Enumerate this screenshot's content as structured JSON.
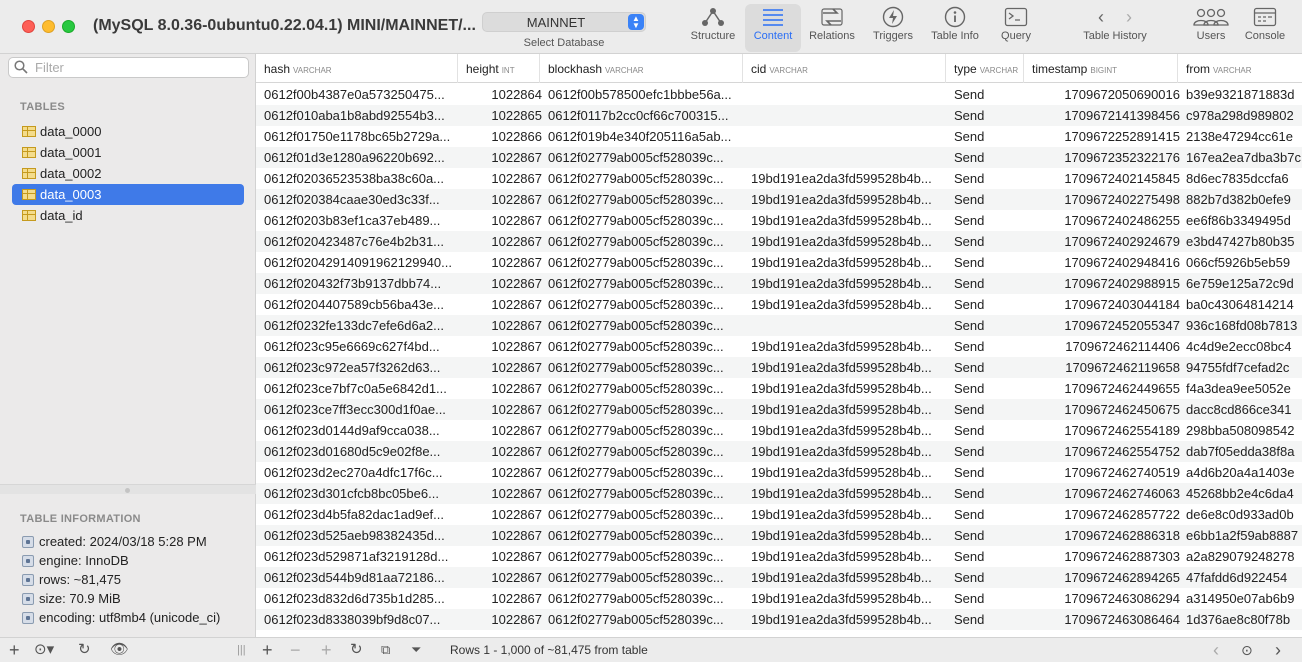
{
  "window": {
    "title": "(MySQL 8.0.36-0ubuntu0.22.04.1) MINI/MAINNET/..."
  },
  "db_select": {
    "value": "MAINNET",
    "caption": "Select Database"
  },
  "toolbar": {
    "structure": "Structure",
    "content": "Content",
    "relations": "Relations",
    "triggers": "Triggers",
    "table_info": "Table Info",
    "query": "Query",
    "table_history": "Table History",
    "users": "Users",
    "console": "Console"
  },
  "sidebar": {
    "filter_placeholder": "Filter",
    "tables_heading": "TABLES",
    "tables": [
      "data_0000",
      "data_0001",
      "data_0002",
      "data_0003",
      "data_id"
    ],
    "info_heading": "TABLE INFORMATION",
    "info": [
      "created: 2024/03/18 5:28 PM",
      "engine: InnoDB",
      "rows: ~81,475",
      "size: 70.9 MiB",
      "encoding: utf8mb4 (unicode_ci)"
    ]
  },
  "grid": {
    "columns": [
      {
        "name": "hash",
        "type": "VARCHAR"
      },
      {
        "name": "height",
        "type": "INT"
      },
      {
        "name": "blockhash",
        "type": "VARCHAR"
      },
      {
        "name": "cid",
        "type": "VARCHAR"
      },
      {
        "name": "type",
        "type": "VARCHAR"
      },
      {
        "name": "timestamp",
        "type": "BIGINT"
      },
      {
        "name": "from",
        "type": "VARCHAR"
      }
    ],
    "rows": [
      [
        "0612f00b4387e0a573250475...",
        "1022864",
        "0612f00b578500efc1bbbe56a...",
        "",
        "Send",
        "1709672050690016",
        "b39e9321871883d"
      ],
      [
        "0612f010aba1b8abd92554b3...",
        "1022865",
        "0612f0117b2cc0cf66c700315...",
        "",
        "Send",
        "1709672141398456",
        "c978a298d989802"
      ],
      [
        "0612f01750e1178bc65b2729a...",
        "1022866",
        "0612f019b4e340f205116a5ab...",
        "",
        "Send",
        "1709672252891415",
        "2138e47294cc61e"
      ],
      [
        "0612f01d3e1280a96220b692...",
        "1022867",
        "0612f02779ab005cf528039c...",
        "",
        "Send",
        "1709672352322176",
        "167ea2ea7dba3b7c"
      ],
      [
        "0612f02036523538ba38c60a...",
        "1022867",
        "0612f02779ab005cf528039c...",
        "19bd191ea2da3fd599528b4b...",
        "Send",
        "1709672402145845",
        "8d6ec7835dccfa6"
      ],
      [
        "0612f020384caae30ed3c33f...",
        "1022867",
        "0612f02779ab005cf528039c...",
        "19bd191ea2da3fd599528b4b...",
        "Send",
        "1709672402275498",
        "882b7d382b0efe9"
      ],
      [
        "0612f0203b83ef1ca37eb489...",
        "1022867",
        "0612f02779ab005cf528039c...",
        "19bd191ea2da3fd599528b4b...",
        "Send",
        "1709672402486255",
        "ee6f86b3349495d"
      ],
      [
        "0612f020423487c76e4b2b31...",
        "1022867",
        "0612f02779ab005cf528039c...",
        "19bd191ea2da3fd599528b4b...",
        "Send",
        "1709672402924679",
        "e3bd47427b80b35"
      ],
      [
        "0612f02042914091962129940...",
        "1022867",
        "0612f02779ab005cf528039c...",
        "19bd191ea2da3fd599528b4b...",
        "Send",
        "1709672402948416",
        "066cf5926b5eb59"
      ],
      [
        "0612f020432f73b9137dbb74...",
        "1022867",
        "0612f02779ab005cf528039c...",
        "19bd191ea2da3fd599528b4b...",
        "Send",
        "1709672402988915",
        "6e759e125a72c9d"
      ],
      [
        "0612f0204407589cb56ba43e...",
        "1022867",
        "0612f02779ab005cf528039c...",
        "19bd191ea2da3fd599528b4b...",
        "Send",
        "1709672403044184",
        "ba0c43064814214"
      ],
      [
        "0612f0232fe133dc7efe6d6a2...",
        "1022867",
        "0612f02779ab005cf528039c...",
        "",
        "Send",
        "1709672452055347",
        "936c168fd08b7813"
      ],
      [
        "0612f023c95e6669c627f4bd...",
        "1022867",
        "0612f02779ab005cf528039c...",
        "19bd191ea2da3fd599528b4b...",
        "Send",
        "1709672462114406",
        "4c4d9e2ecc08bc4"
      ],
      [
        "0612f023c972ea57f3262d63...",
        "1022867",
        "0612f02779ab005cf528039c...",
        "19bd191ea2da3fd599528b4b...",
        "Send",
        "1709672462119658",
        "94755fdf7cefad2c"
      ],
      [
        "0612f023ce7bf7c0a5e6842d1...",
        "1022867",
        "0612f02779ab005cf528039c...",
        "19bd191ea2da3fd599528b4b...",
        "Send",
        "1709672462449655",
        "f4a3dea9ee5052e"
      ],
      [
        "0612f023ce7ff3ecc300d1f0ae...",
        "1022867",
        "0612f02779ab005cf528039c...",
        "19bd191ea2da3fd599528b4b...",
        "Send",
        "1709672462450675",
        "dacc8cd866ce341"
      ],
      [
        "0612f023d0144d9af9cca038...",
        "1022867",
        "0612f02779ab005cf528039c...",
        "19bd191ea2da3fd599528b4b...",
        "Send",
        "1709672462554189",
        "298bba508098542"
      ],
      [
        "0612f023d01680d5c9e02f8e...",
        "1022867",
        "0612f02779ab005cf528039c...",
        "19bd191ea2da3fd599528b4b...",
        "Send",
        "1709672462554752",
        "dab7f05edda38f8a"
      ],
      [
        "0612f023d2ec270a4dfc17f6c...",
        "1022867",
        "0612f02779ab005cf528039c...",
        "19bd191ea2da3fd599528b4b...",
        "Send",
        "1709672462740519",
        "a4d6b20a4a1403e"
      ],
      [
        "0612f023d301cfcb8bc05be6...",
        "1022867",
        "0612f02779ab005cf528039c...",
        "19bd191ea2da3fd599528b4b...",
        "Send",
        "1709672462746063",
        "45268bb2e4c6da4"
      ],
      [
        "0612f023d4b5fa82dac1ad9ef...",
        "1022867",
        "0612f02779ab005cf528039c...",
        "19bd191ea2da3fd599528b4b...",
        "Send",
        "1709672462857722",
        "de6e8c0d933ad0b"
      ],
      [
        "0612f023d525aeb98382435d...",
        "1022867",
        "0612f02779ab005cf528039c...",
        "19bd191ea2da3fd599528b4b...",
        "Send",
        "1709672462886318",
        "e6bb1a2f59ab8887"
      ],
      [
        "0612f023d529871af3219128d...",
        "1022867",
        "0612f02779ab005cf528039c...",
        "19bd191ea2da3fd599528b4b...",
        "Send",
        "1709672462887303",
        "a2a829079248278"
      ],
      [
        "0612f023d544b9d81aa72186...",
        "1022867",
        "0612f02779ab005cf528039c...",
        "19bd191ea2da3fd599528b4b...",
        "Send",
        "1709672462894265",
        "47fafdd6d922454"
      ],
      [
        "0612f023d832d6d735b1d285...",
        "1022867",
        "0612f02779ab005cf528039c...",
        "19bd191ea2da3fd599528b4b...",
        "Send",
        "1709672463086294",
        "a314950e07ab6b9"
      ],
      [
        "0612f023d8338039bf9d8c07...",
        "1022867",
        "0612f02779ab005cf528039c...",
        "19bd191ea2da3fd599528b4b...",
        "Send",
        "1709672463086464",
        "1d376ae8c80f78b"
      ]
    ]
  },
  "status": {
    "text": "Rows 1 - 1,000 of ~81,475 from table"
  },
  "colors": {
    "accent": "#2a6ef5",
    "selection": "#3f7ae8"
  }
}
